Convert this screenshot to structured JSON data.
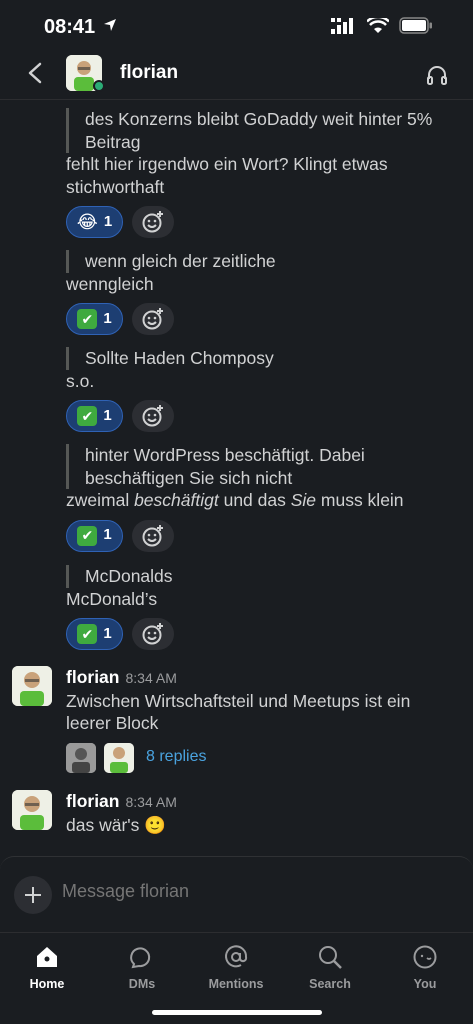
{
  "status": {
    "time": "08:41"
  },
  "header": {
    "name": "florian"
  },
  "messages": [
    {
      "quote": "des Konzerns bleibt GoDaddy weit hinter 5% Beitrag",
      "text": "fehlt hier irgendwo ein Wort? Klingt etwas stichworthaft",
      "reaction": {
        "emoji": "😂",
        "count": "1"
      }
    },
    {
      "quote": "wenn gleich der zeitliche",
      "text": "wenngleich",
      "reaction": {
        "emoji": "✔",
        "count": "1"
      }
    },
    {
      "quote": "Sollte Haden Chomposy",
      "text": "s.o.",
      "reaction": {
        "emoji": "✔",
        "count": "1"
      }
    },
    {
      "quote": "hinter WordPress beschäftigt. Dabei beschäftigen Sie sich nicht",
      "text_parts": [
        "zweimal ",
        "beschäftigt",
        " und das ",
        "Sie",
        " muss klein"
      ],
      "reaction": {
        "emoji": "✔",
        "count": "1"
      }
    },
    {
      "quote": "McDonalds",
      "text": "McDonald’s",
      "reaction": {
        "emoji": "✔",
        "count": "1"
      }
    }
  ],
  "posts": [
    {
      "author": "florian",
      "time": "8:34 AM",
      "text": "Zwischen Wirtschaftsteil und Meetups ist ein leerer Block",
      "replies": "8 replies"
    },
    {
      "author": "florian",
      "time": "8:34 AM",
      "text": "das wär's",
      "emoji": "🙂"
    }
  ],
  "composer": {
    "placeholder": "Message florian"
  },
  "tabs": [
    {
      "label": "Home",
      "icon": "home-icon"
    },
    {
      "label": "DMs",
      "icon": "dms-icon"
    },
    {
      "label": "Mentions",
      "icon": "at-icon"
    },
    {
      "label": "Search",
      "icon": "search-icon"
    },
    {
      "label": "You",
      "icon": "you-icon"
    }
  ],
  "colors": {
    "background": "#1a1d21",
    "reaction_bg": "#1d3e72",
    "reaction_border": "#2f62b5",
    "link": "#4aa3df",
    "presence": "#2bac76"
  }
}
